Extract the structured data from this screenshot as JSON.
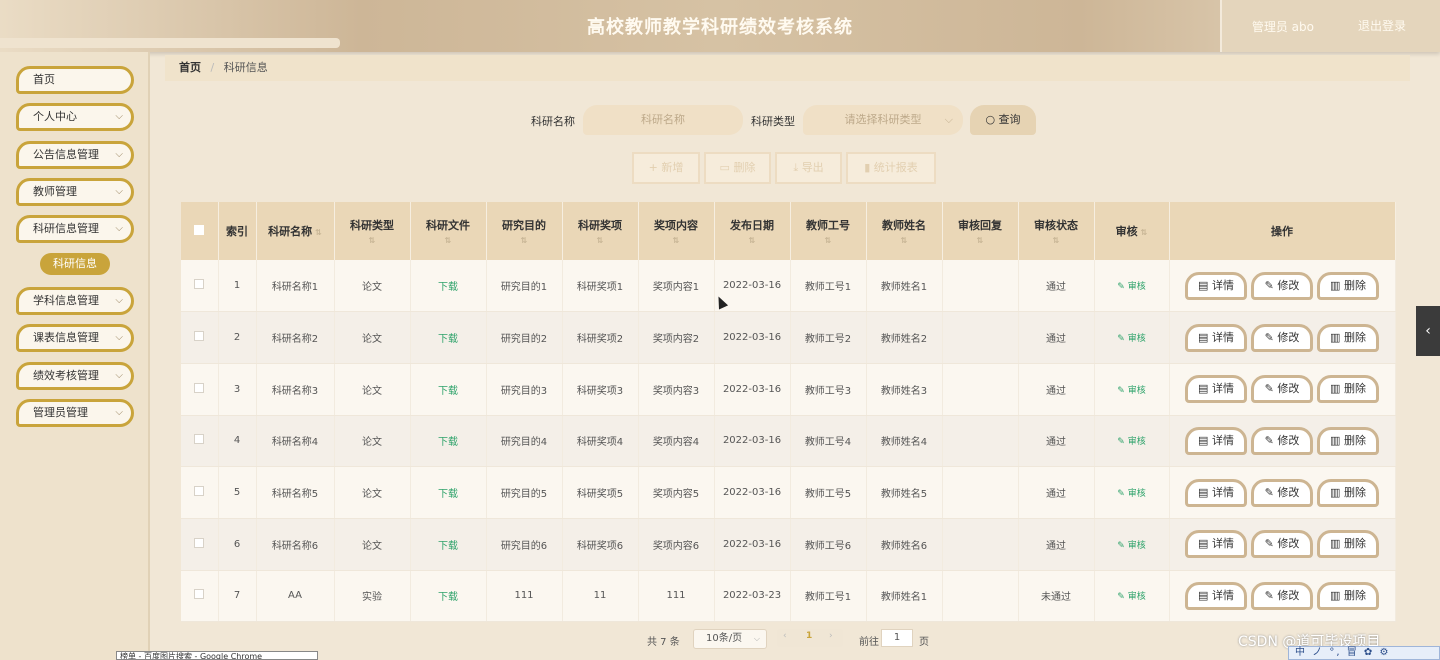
{
  "header": {
    "title": "高校教师教学科研绩效考核系统",
    "user": "管理员 abo",
    "logout": "退出登录"
  },
  "sidebar": {
    "items": [
      {
        "label": "首页",
        "chevron": false
      },
      {
        "label": "个人中心",
        "chevron": true
      },
      {
        "label": "公告信息管理",
        "chevron": true
      },
      {
        "label": "教师管理",
        "chevron": true
      },
      {
        "label": "科研信息管理",
        "chevron": true
      },
      {
        "label": "学科信息管理",
        "chevron": true
      },
      {
        "label": "课表信息管理",
        "chevron": true
      },
      {
        "label": "绩效考核管理",
        "chevron": true
      },
      {
        "label": "管理员管理",
        "chevron": true
      }
    ],
    "active_sub": "科研信息"
  },
  "breadcrumb": {
    "home": "首页",
    "sep": "/",
    "current": "科研信息"
  },
  "search": {
    "name_label": "科研名称",
    "name_placeholder": "科研名称",
    "type_label": "科研类型",
    "type_placeholder": "请选择科研类型",
    "button": "查询"
  },
  "actions": {
    "add": "+ 新增",
    "delete": "删除",
    "export": "导出",
    "report": "统计报表"
  },
  "table": {
    "columns": [
      "索引",
      "科研名称",
      "科研类型",
      "科研文件",
      "研究目的",
      "科研奖项",
      "奖项内容",
      "发布日期",
      "教师工号",
      "教师姓名",
      "审核回复",
      "审核状态",
      "审核",
      "操作"
    ],
    "rows": [
      {
        "index": "1",
        "name": "科研名称1",
        "type": "论文",
        "file": "下载",
        "purpose": "研究目的1",
        "award": "科研奖项1",
        "award_content": "奖项内容1",
        "date": "2022-03-16",
        "teacher_no": "教师工号1",
        "teacher_name": "教师姓名1",
        "reply": "",
        "status": "通过",
        "audit": "审核"
      },
      {
        "index": "2",
        "name": "科研名称2",
        "type": "论文",
        "file": "下载",
        "purpose": "研究目的2",
        "award": "科研奖项2",
        "award_content": "奖项内容2",
        "date": "2022-03-16",
        "teacher_no": "教师工号2",
        "teacher_name": "教师姓名2",
        "reply": "",
        "status": "通过",
        "audit": "审核"
      },
      {
        "index": "3",
        "name": "科研名称3",
        "type": "论文",
        "file": "下载",
        "purpose": "研究目的3",
        "award": "科研奖项3",
        "award_content": "奖项内容3",
        "date": "2022-03-16",
        "teacher_no": "教师工号3",
        "teacher_name": "教师姓名3",
        "reply": "",
        "status": "通过",
        "audit": "审核"
      },
      {
        "index": "4",
        "name": "科研名称4",
        "type": "论文",
        "file": "下载",
        "purpose": "研究目的4",
        "award": "科研奖项4",
        "award_content": "奖项内容4",
        "date": "2022-03-16",
        "teacher_no": "教师工号4",
        "teacher_name": "教师姓名4",
        "reply": "",
        "status": "通过",
        "audit": "审核"
      },
      {
        "index": "5",
        "name": "科研名称5",
        "type": "论文",
        "file": "下载",
        "purpose": "研究目的5",
        "award": "科研奖项5",
        "award_content": "奖项内容5",
        "date": "2022-03-16",
        "teacher_no": "教师工号5",
        "teacher_name": "教师姓名5",
        "reply": "",
        "status": "通过",
        "audit": "审核"
      },
      {
        "index": "6",
        "name": "科研名称6",
        "type": "论文",
        "file": "下载",
        "purpose": "研究目的6",
        "award": "科研奖项6",
        "award_content": "奖项内容6",
        "date": "2022-03-16",
        "teacher_no": "教师工号6",
        "teacher_name": "教师姓名6",
        "reply": "",
        "status": "通过",
        "audit": "审核"
      },
      {
        "index": "7",
        "name": "AA",
        "type": "实验",
        "file": "下载",
        "purpose": "111",
        "award": "11",
        "award_content": "111",
        "date": "2022-03-23",
        "teacher_no": "教师工号1",
        "teacher_name": "教师姓名1",
        "reply": "",
        "status": "未通过",
        "audit": "审核"
      }
    ],
    "op_buttons": {
      "detail": "详情",
      "edit": "修改",
      "delete": "删除"
    }
  },
  "pager": {
    "total": "共 7 条",
    "page_size": "10条/页",
    "current_page": "1",
    "goto_label": "前往",
    "goto_value": "1",
    "page_unit": "页"
  },
  "overlay": {
    "watermark": "CSDN @道可毕设项目",
    "tooltip": "榜单 - 百度图片搜索 - Google Chrome",
    "ime": "中 ノ °, 冒 ✿ ⚙"
  },
  "colors": {
    "accent_gold": "#c9a43b",
    "header_tan": "#cdb697",
    "table_header": "#ead7b7",
    "link_green": "#2fa36b"
  }
}
